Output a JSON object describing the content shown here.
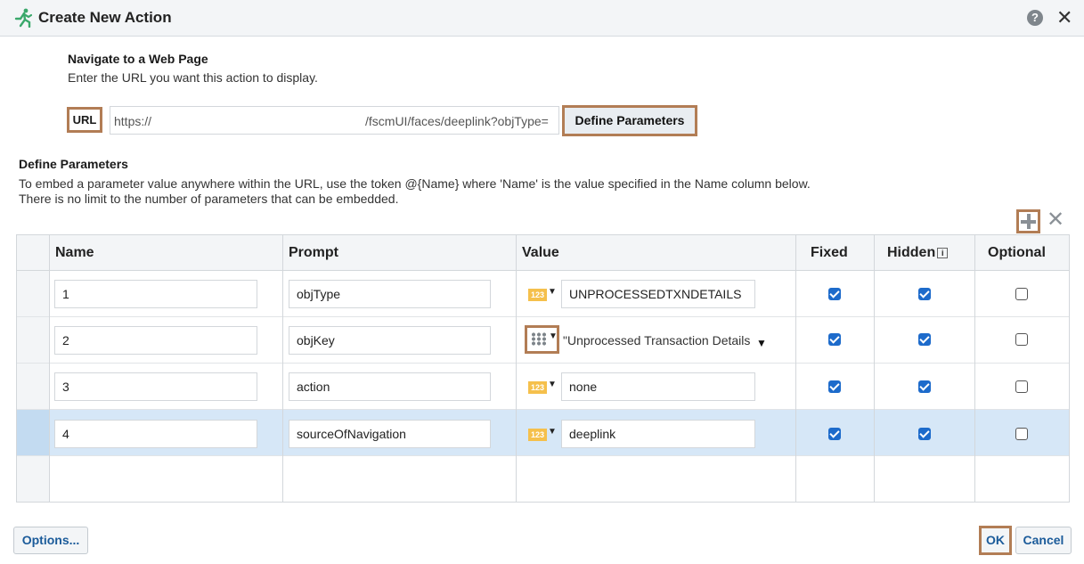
{
  "dialog": {
    "title": "Create New Action",
    "help_icon": "help-icon",
    "help_glyph": "?",
    "close_icon": "close-icon",
    "close_glyph": "✕"
  },
  "navigate": {
    "heading": "Navigate to a Web Page",
    "description": "Enter the URL you want this action to display.",
    "url_label": "URL",
    "url_value_start": "https://",
    "url_value_end": "/fscmUI/faces/deeplink?objType=",
    "define_button": "Define Parameters"
  },
  "define_parameters": {
    "heading": "Define Parameters",
    "line1": "To embed a parameter value anywhere within the URL, use the token @{Name} where 'Name' is the value specified in the Name column below.",
    "line2": "There is no limit to the number of parameters that can be embedded.",
    "add_icon": "add-icon",
    "delete_icon": "delete-icon",
    "delete_glyph": "✕"
  },
  "table": {
    "columns": [
      "Name",
      "Prompt",
      "Value",
      "Fixed",
      "Hidden",
      "Optional"
    ],
    "hidden_info_glyph": "i",
    "num_badge": "123",
    "rows": [
      {
        "name": "1",
        "prompt": "objType",
        "value_type": "number",
        "value": "UNPROCESSEDTXNDETAILS",
        "fixed": true,
        "hidden": true,
        "optional": false,
        "selected": false
      },
      {
        "name": "2",
        "prompt": "objKey",
        "value_type": "list",
        "value": "\"Unprocessed Transaction Details\"",
        "fixed": true,
        "hidden": true,
        "optional": false,
        "selected": false
      },
      {
        "name": "3",
        "prompt": "action",
        "value_type": "number",
        "value": "none",
        "fixed": true,
        "hidden": true,
        "optional": false,
        "selected": false
      },
      {
        "name": "4",
        "prompt": "sourceOfNavigation",
        "value_type": "number",
        "value": "deeplink",
        "fixed": true,
        "hidden": true,
        "optional": false,
        "selected": true
      }
    ]
  },
  "footer": {
    "options_button": "Options...",
    "ok_button": "OK",
    "cancel_button": "Cancel"
  },
  "colors": {
    "highlight": "#b27d55",
    "accent_blue": "#1d6bcb",
    "selected_row": "#d6e7f7"
  }
}
